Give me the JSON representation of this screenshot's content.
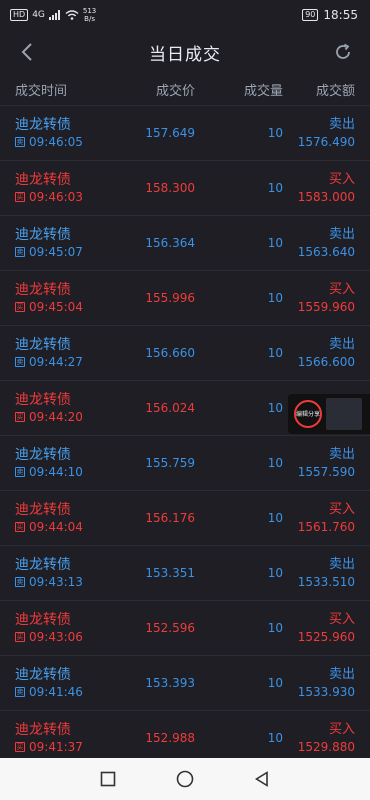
{
  "status": {
    "left_badge": "HD",
    "signal": "4G",
    "speed_value": "513",
    "speed_unit": "B/s",
    "battery": "90",
    "time": "18:55"
  },
  "header": {
    "title": "当日成交"
  },
  "columns": {
    "time": "成交时间",
    "price": "成交价",
    "qty": "成交量",
    "amount": "成交额"
  },
  "rows": [
    {
      "name": "迪龙转债",
      "tag": "卖",
      "time": "09:46:05",
      "price": "157.649",
      "qty": "10",
      "dir": "卖出",
      "amount": "1576.490",
      "side": "sell"
    },
    {
      "name": "迪龙转债",
      "tag": "买",
      "time": "09:46:03",
      "price": "158.300",
      "qty": "10",
      "dir": "买入",
      "amount": "1583.000",
      "side": "buy"
    },
    {
      "name": "迪龙转债",
      "tag": "卖",
      "time": "09:45:07",
      "price": "156.364",
      "qty": "10",
      "dir": "卖出",
      "amount": "1563.640",
      "side": "sell"
    },
    {
      "name": "迪龙转债",
      "tag": "买",
      "time": "09:45:04",
      "price": "155.996",
      "qty": "10",
      "dir": "买入",
      "amount": "1559.960",
      "side": "buy"
    },
    {
      "name": "迪龙转债",
      "tag": "卖",
      "time": "09:44:27",
      "price": "156.660",
      "qty": "10",
      "dir": "卖出",
      "amount": "1566.600",
      "side": "sell"
    },
    {
      "name": "迪龙转债",
      "tag": "买",
      "time": "09:44:20",
      "price": "156.024",
      "qty": "10",
      "dir": "买入",
      "amount": "",
      "side": "buy"
    },
    {
      "name": "迪龙转债",
      "tag": "卖",
      "time": "09:44:10",
      "price": "155.759",
      "qty": "10",
      "dir": "卖出",
      "amount": "1557.590",
      "side": "sell"
    },
    {
      "name": "迪龙转债",
      "tag": "买",
      "time": "09:44:04",
      "price": "156.176",
      "qty": "10",
      "dir": "买入",
      "amount": "1561.760",
      "side": "buy"
    },
    {
      "name": "迪龙转债",
      "tag": "卖",
      "time": "09:43:13",
      "price": "153.351",
      "qty": "10",
      "dir": "卖出",
      "amount": "1533.510",
      "side": "sell"
    },
    {
      "name": "迪龙转债",
      "tag": "买",
      "time": "09:43:06",
      "price": "152.596",
      "qty": "10",
      "dir": "买入",
      "amount": "1525.960",
      "side": "buy"
    },
    {
      "name": "迪龙转债",
      "tag": "卖",
      "time": "09:41:46",
      "price": "153.393",
      "qty": "10",
      "dir": "卖出",
      "amount": "1533.930",
      "side": "sell"
    },
    {
      "name": "迪龙转债",
      "tag": "买",
      "time": "09:41:37",
      "price": "152.988",
      "qty": "10",
      "dir": "买入",
      "amount": "1529.880",
      "side": "buy"
    }
  ],
  "floater": {
    "label": "编辑分享"
  },
  "colors": {
    "sell": "#3c92e6",
    "buy": "#f03b3b",
    "background": "#1e1e24"
  },
  "icons": {
    "back": "chevron-left-icon",
    "refresh": "refresh-icon",
    "home": "circle-home-icon",
    "recents": "square-recents-icon",
    "sys_back": "triangle-back-icon"
  }
}
